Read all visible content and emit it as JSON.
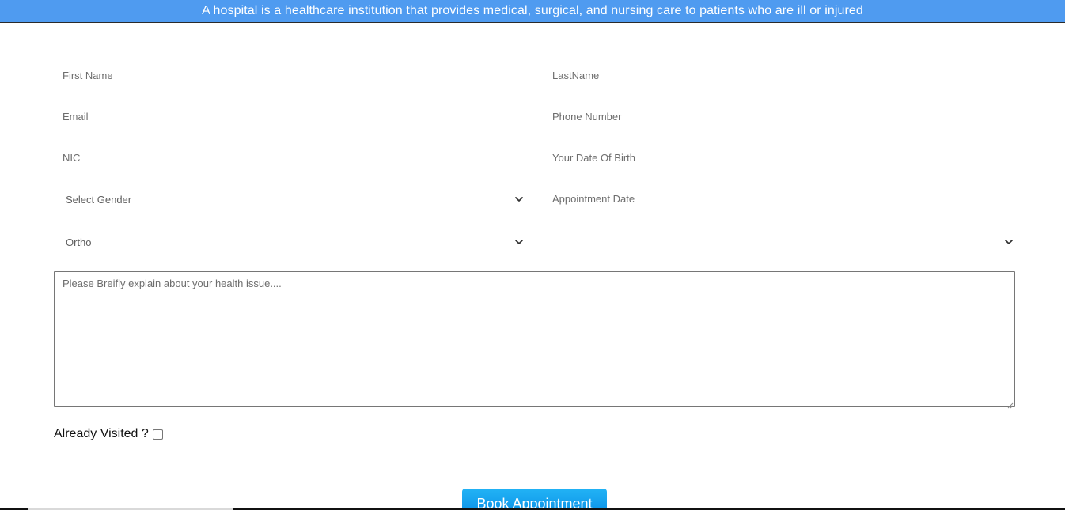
{
  "banner": {
    "text": "A hospital is a healthcare institution that provides medical, surgical, and nursing care to patients who are ill or injured"
  },
  "form": {
    "first_name_placeholder": "First Name",
    "last_name_placeholder": "LastName",
    "email_placeholder": "Email",
    "phone_placeholder": "Phone Number",
    "nic_placeholder": "NIC",
    "dob_placeholder": "Your Date Of Birth",
    "gender_selected": "Select Gender",
    "appointment_date_placeholder": "Appointment Date",
    "department_selected": "Ortho",
    "doctor_selected": "",
    "health_issue_placeholder": "Please Breifly explain about your health issue....",
    "already_visited_label": "Already Visited ?",
    "submit_label": "Book Appointment"
  },
  "colors": {
    "banner": "#4f9bf0",
    "button": "#0a8fe6"
  },
  "icons": {
    "select_arrow": "chevron-down-icon"
  }
}
